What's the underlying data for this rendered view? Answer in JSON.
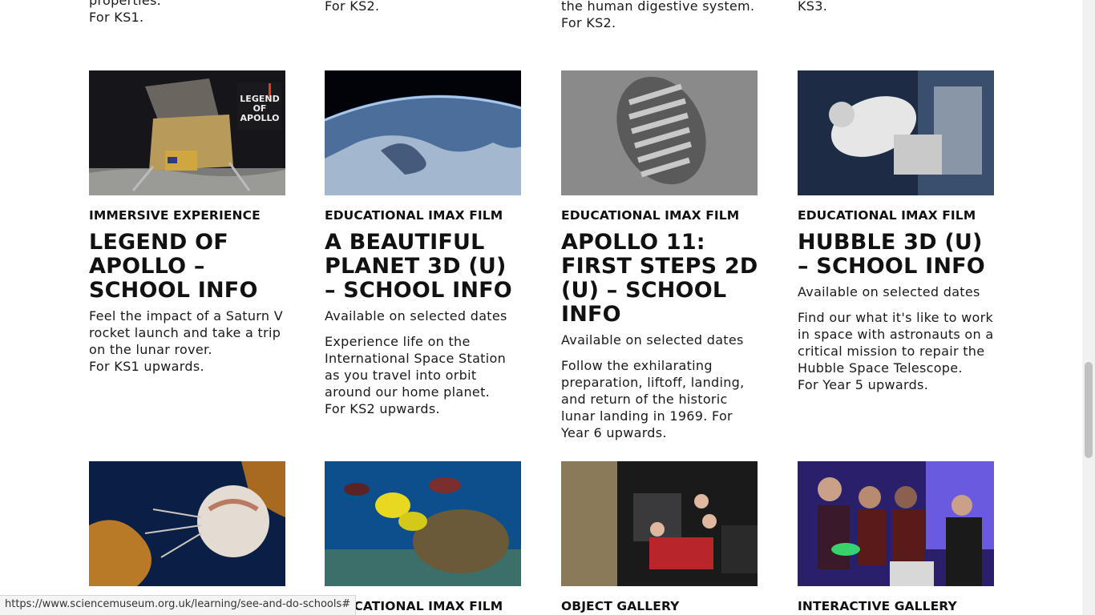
{
  "previous_row": [
    {
      "lines": [
        "properties.",
        "For KS1."
      ]
    },
    {
      "lines": [
        "For KS2."
      ]
    },
    {
      "lines": [
        "the human digestive system.",
        "For KS2."
      ]
    },
    {
      "lines": [
        "KS3."
      ]
    }
  ],
  "cards": [
    {
      "category": "IMMERSIVE EXPERIENCE",
      "title": "LEGEND OF APOLLO – SCHOOL INFO",
      "availability": "",
      "description": "Feel the impact of a Saturn V rocket launch and take a trip on the lunar rover.",
      "audience": "For KS1 upwards.",
      "image_overlay": "LEGEND OF APOLLO"
    },
    {
      "category": "EDUCATIONAL IMAX FILM",
      "title": "A BEAUTIFUL PLANET 3D (U) – SCHOOL INFO",
      "availability": "Available on selected dates",
      "description": "Experience life on the International Space Station as you travel into orbit around our home planet.",
      "audience": "For KS2 upwards."
    },
    {
      "category": "EDUCATIONAL IMAX FILM",
      "title": "APOLLO 11: FIRST STEPS 2D (U) – SCHOOL INFO",
      "availability": "Available on selected dates",
      "description": "Follow the exhilarating preparation, liftoff, landing, and return of the historic lunar landing in 1969. For Year 6 upwards.",
      "audience": ""
    },
    {
      "category": "EDUCATIONAL IMAX FILM",
      "title": "HUBBLE 3D (U) – SCHOOL INFO",
      "availability": "Available on selected dates",
      "description": "Find our what it's like to work in space with astronauts on a critical mission to repair the Hubble Space Telescope.",
      "audience": "For Year 5 upwards."
    }
  ],
  "next_row": [
    {
      "category": ""
    },
    {
      "category": "EDUCATIONAL IMAX FILM"
    },
    {
      "category": "OBJECT GALLERY"
    },
    {
      "category": "INTERACTIVE GALLERY"
    }
  ],
  "status_bar": {
    "url": "https://www.sciencemuseum.org.uk/learning/see-and-do-schools#"
  }
}
